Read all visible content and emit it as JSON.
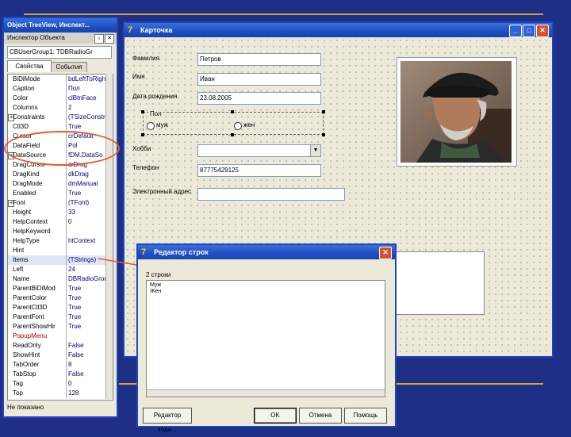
{
  "inspector": {
    "title": "Object TreeView, Инспект...",
    "subtitle": "Инспектор Объекта",
    "selector_value": "CBUserGroup1: TDBRadioGr",
    "tabs": [
      "Свойства",
      "События"
    ],
    "properties": [
      {
        "name": "BiDiMode",
        "value": "bdLeftToRight"
      },
      {
        "name": "Caption",
        "value": "Пол"
      },
      {
        "name": "Color",
        "value": "clBtnFace"
      },
      {
        "name": "Columns",
        "value": "2"
      },
      {
        "name": "Constraints",
        "value": "(TSizeConstra"
      },
      {
        "name": "Ctl3D",
        "value": "True"
      },
      {
        "name": "Cursor",
        "value": "crDefault"
      },
      {
        "name": "DataField",
        "value": "Pol"
      },
      {
        "name": "DataSource",
        "value": "fDM.DataSo"
      },
      {
        "name": "DragCursor",
        "value": "crDrag"
      },
      {
        "name": "DragKind",
        "value": "dkDrag"
      },
      {
        "name": "DragMode",
        "value": "dmManual"
      },
      {
        "name": "Enabled",
        "value": "True"
      },
      {
        "name": "Font",
        "value": "(TFont)"
      },
      {
        "name": "Height",
        "value": "33"
      },
      {
        "name": "HelpContext",
        "value": "0"
      },
      {
        "name": "HelpKeyword",
        "value": ""
      },
      {
        "name": "HelpType",
        "value": "htContext"
      },
      {
        "name": "Hint",
        "value": ""
      },
      {
        "name": "Items",
        "value": "(TStrings)"
      },
      {
        "name": "Left",
        "value": "24"
      },
      {
        "name": "Name",
        "value": "DBRadioGrou"
      },
      {
        "name": "ParentBiDiMod",
        "value": "True"
      },
      {
        "name": "ParentColor",
        "value": "True"
      },
      {
        "name": "ParentCtl3D",
        "value": "True"
      },
      {
        "name": "ParentFont",
        "value": "True"
      },
      {
        "name": "ParentShowHir",
        "value": "True"
      },
      {
        "name": "PopupMenu",
        "value": ""
      },
      {
        "name": "ReadOnly",
        "value": "False"
      },
      {
        "name": "ShowHint",
        "value": "False"
      },
      {
        "name": "TabOrder",
        "value": "8"
      },
      {
        "name": "TabStop",
        "value": "False"
      },
      {
        "name": "Tag",
        "value": "0"
      },
      {
        "name": "Top",
        "value": "128"
      }
    ],
    "status": "Не показано"
  },
  "card": {
    "title": "Карточка",
    "labels": {
      "surname": "Фамилия",
      "name": "Имя",
      "birthdate": "Дата рождения",
      "gender_group": "Пол",
      "hobby": "Хобби",
      "phone": "Телефон",
      "email": "Электронный адрес"
    },
    "values": {
      "surname": "Петров",
      "name": "Иван",
      "birthdate": "23.08.2005",
      "hobby": "",
      "phone": "87775429125",
      "email": ""
    },
    "radio": {
      "male": "муж",
      "female": "жен"
    }
  },
  "editor": {
    "title": "Редактор строк",
    "count": "2 строки",
    "lines": [
      "Муж",
      "Жен"
    ],
    "buttons": {
      "code": "Редактор кода...",
      "ok": "OK",
      "cancel": "Отмена",
      "help": "Помощь"
    }
  },
  "colors": {
    "slide_bg": "#1f2f86",
    "accent": "#c8a93a",
    "highlight_circle": "#e85a2a",
    "xp_title": "#1f4fc4"
  }
}
